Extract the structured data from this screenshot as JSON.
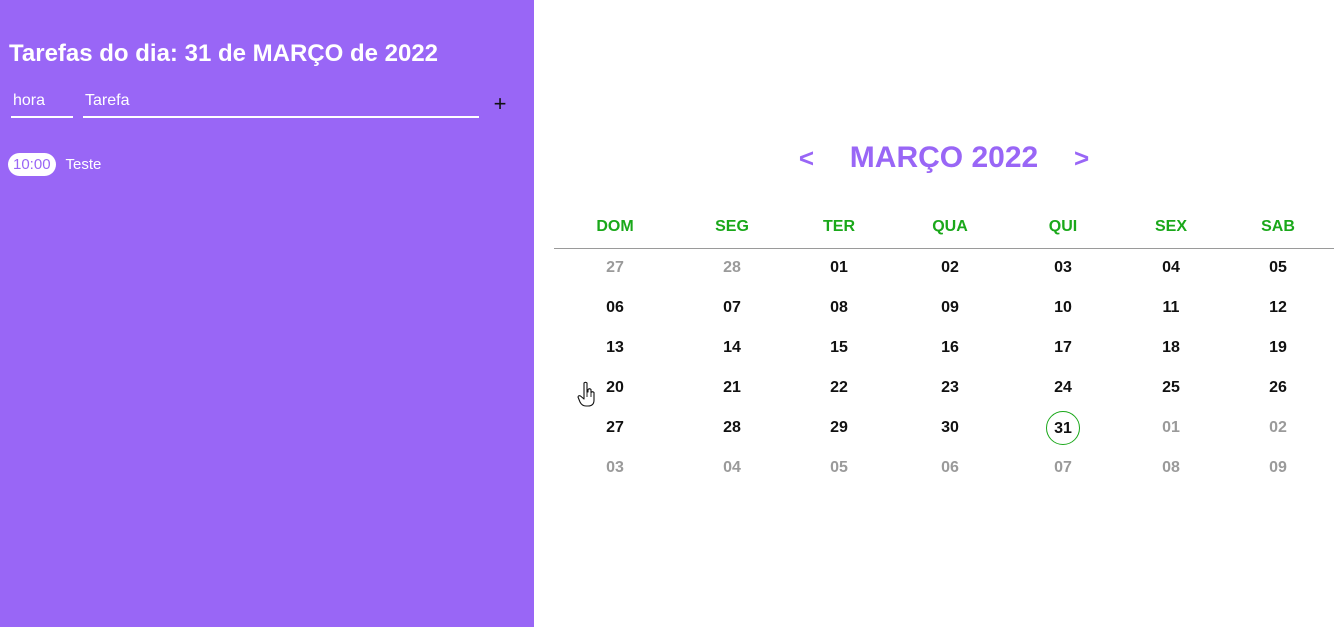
{
  "sidebar": {
    "title": "Tarefas do dia: 31 de MARÇO de 2022",
    "hora_placeholder": "hora",
    "tarefa_placeholder": "Tarefa",
    "add_label": "+",
    "tasks": [
      {
        "time": "10:00",
        "title": "Teste"
      }
    ]
  },
  "calendar": {
    "prev_label": "<",
    "next_label": ">",
    "month_label": "MARÇO 2022",
    "weekdays": [
      "DOM",
      "SEG",
      "TER",
      "QUA",
      "QUI",
      "SEX",
      "SAB"
    ],
    "weeks": [
      [
        "27",
        "28",
        "01",
        "02",
        "03",
        "04",
        "05"
      ],
      [
        "06",
        "07",
        "08",
        "09",
        "10",
        "11",
        "12"
      ],
      [
        "13",
        "14",
        "15",
        "16",
        "17",
        "18",
        "19"
      ],
      [
        "20",
        "21",
        "22",
        "23",
        "24",
        "25",
        "26"
      ],
      [
        "27",
        "28",
        "29",
        "30",
        "31",
        "01",
        "02"
      ],
      [
        "03",
        "04",
        "05",
        "06",
        "07",
        "08",
        "09"
      ]
    ],
    "muted_cells": [
      [
        0,
        0
      ],
      [
        0,
        1
      ],
      [
        4,
        5
      ],
      [
        4,
        6
      ],
      [
        5,
        0
      ],
      [
        5,
        1
      ],
      [
        5,
        2
      ],
      [
        5,
        3
      ],
      [
        5,
        4
      ],
      [
        5,
        5
      ],
      [
        5,
        6
      ]
    ],
    "selected_cell": [
      4,
      4
    ]
  },
  "colors": {
    "sidebar_bg": "#9966f6",
    "accent": "#9966f6",
    "weekday": "#1aa81a",
    "today_ring": "#1aa81a",
    "muted": "#9a9a9a"
  }
}
